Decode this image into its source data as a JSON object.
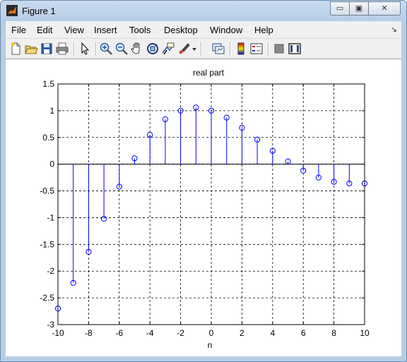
{
  "window": {
    "title": "Figure 1",
    "min_symbol": "▭",
    "max_symbol": "▣",
    "close_symbol": "✕"
  },
  "menubar": {
    "items": [
      "File",
      "Edit",
      "View",
      "Insert",
      "Tools",
      "Desktop",
      "Window",
      "Help"
    ],
    "overflow_symbol": "↘"
  },
  "toolbar": {
    "icons": [
      "new-figure-icon",
      "open-file-icon",
      "save-icon",
      "print-icon",
      "pointer-icon",
      "zoom-in-icon",
      "zoom-out-icon",
      "pan-icon",
      "rotate-3d-icon",
      "data-cursor-icon",
      "brush-icon",
      "brush-dropdown-icon",
      "link-plot-icon",
      "colorbar-icon",
      "legend-icon",
      "hide-plot-tools-icon",
      "show-plot-tools-icon"
    ]
  },
  "chart_data": {
    "type": "stem",
    "title": "real part",
    "xlabel": "n",
    "ylabel": "",
    "xlim": [
      -10,
      10
    ],
    "ylim": [
      -3,
      1.5
    ],
    "xticks": [
      "-10",
      "-8",
      "-6",
      "-4",
      "-2",
      "0",
      "2",
      "4",
      "6",
      "8",
      "10"
    ],
    "yticks": [
      "1.5",
      "1",
      "0.5",
      "0",
      "-0.5",
      "-1",
      "-1.5",
      "-2",
      "-2.5",
      "-3"
    ],
    "grid": true,
    "color": "#0000ff",
    "x": [
      -10,
      -9,
      -8,
      -7,
      -6,
      -5,
      -4,
      -3,
      -2,
      -1,
      0,
      1,
      2,
      3,
      4,
      5,
      6,
      7,
      8,
      9,
      10
    ],
    "y": [
      -2.7,
      -2.22,
      -1.64,
      -1.02,
      -0.42,
      0.11,
      0.55,
      0.84,
      1.0,
      1.06,
      1.0,
      0.87,
      0.68,
      0.46,
      0.25,
      0.05,
      -0.12,
      -0.25,
      -0.33,
      -0.36,
      -0.36
    ]
  }
}
